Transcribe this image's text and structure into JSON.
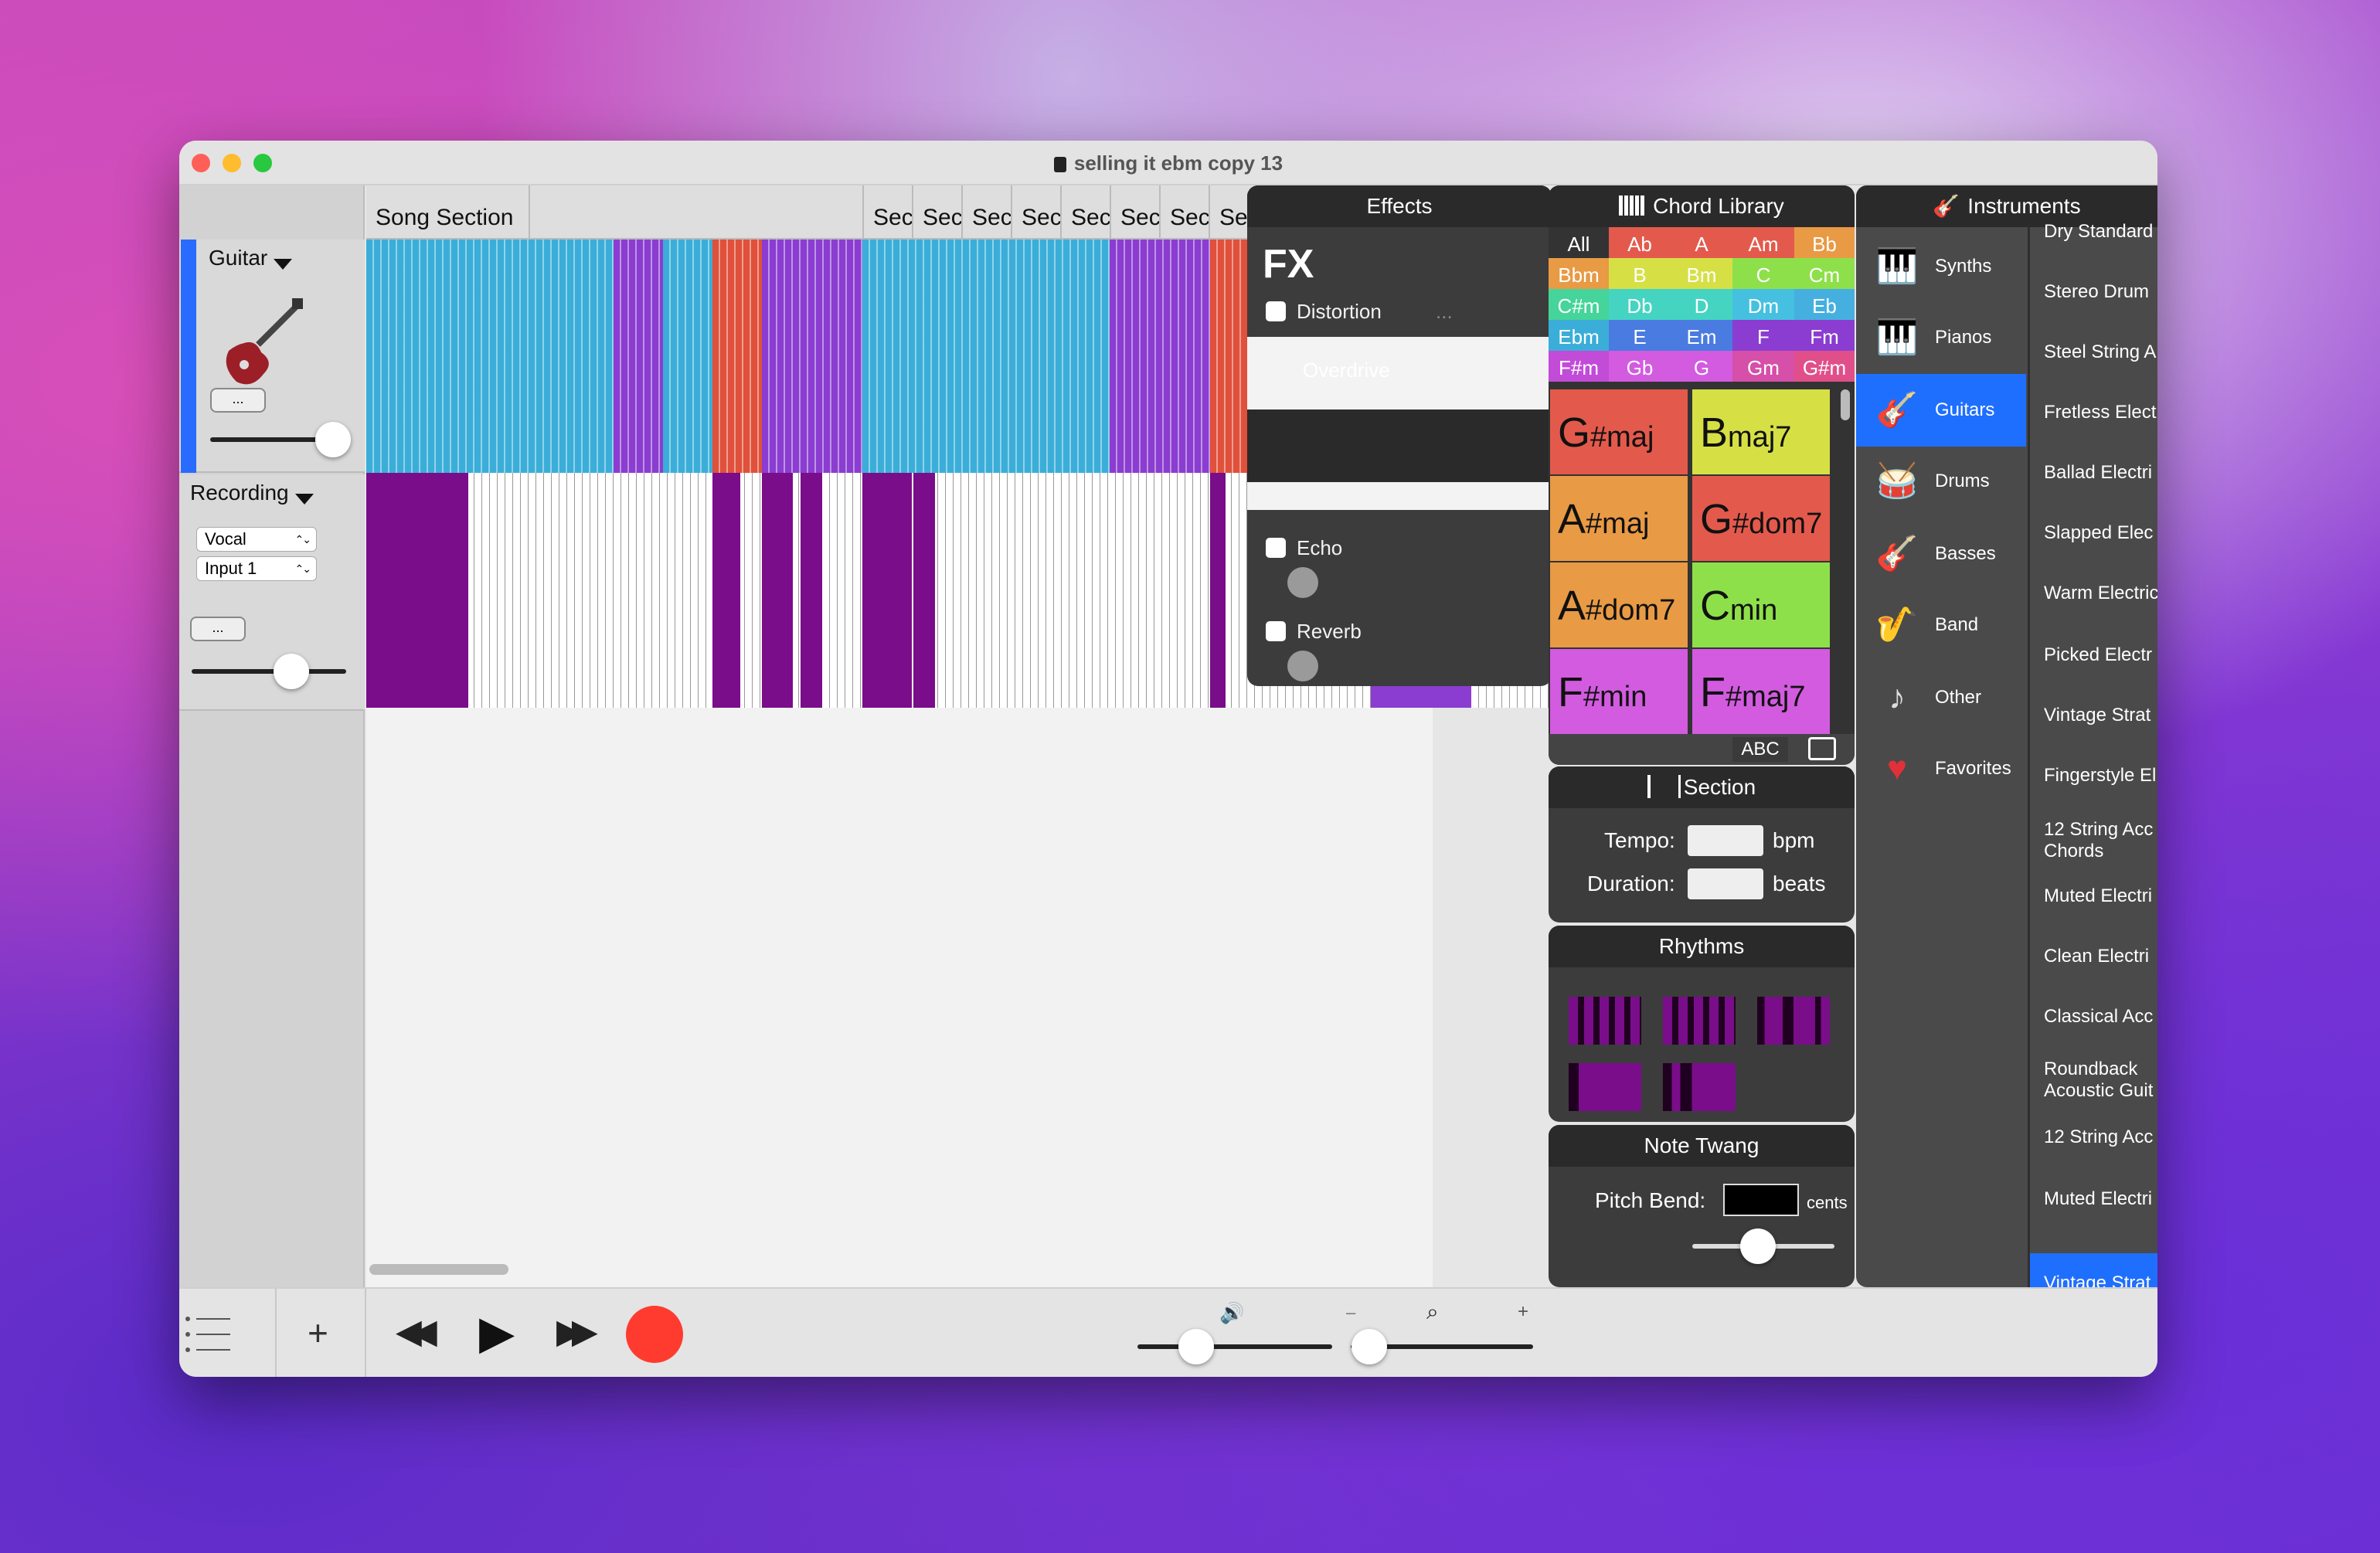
{
  "window": {
    "title": "selling it ebm copy 13"
  },
  "tracks": {
    "track1": {
      "name": "Guitar",
      "more_label": "..."
    },
    "track2": {
      "name": "Recording",
      "type": "Vocal",
      "input": "Input 1",
      "more_label": "..."
    }
  },
  "timeline": {
    "sections": [
      "Song Section",
      "",
      "Sec",
      "Sec",
      "Sec",
      "Sec",
      "Sec",
      "Sec",
      "Sec",
      "Sec"
    ]
  },
  "effects": {
    "title": "Effects",
    "fx_heading": "FX",
    "distortion": "Distortion",
    "distortion_more": "...",
    "overdrive": "Overdrive",
    "echo": "Echo",
    "reverb": "Reverb"
  },
  "chord_library": {
    "title": "Chord Library",
    "keys": [
      [
        "All",
        "Ab",
        "A",
        "Am",
        "Bb"
      ],
      [
        "Bbm",
        "B",
        "Bm",
        "C",
        "Cm"
      ],
      [
        "C#m",
        "Db",
        "D",
        "Dm",
        "Eb"
      ],
      [
        "Ebm",
        "E",
        "Em",
        "F",
        "Fm"
      ],
      [
        "F#m",
        "Gb",
        "G",
        "Gm",
        "G#m"
      ]
    ],
    "cards": [
      {
        "root": "G",
        "suffix": "#maj",
        "color": "#e35a4c"
      },
      {
        "root": "B",
        "suffix": "maj7",
        "color": "#d6e045"
      },
      {
        "root": "A",
        "suffix": "#maj",
        "color": "#e89a45"
      },
      {
        "root": "G",
        "suffix": "#dom7",
        "color": "#e35a4c"
      },
      {
        "root": "A",
        "suffix": "#dom7",
        "color": "#e89a45"
      },
      {
        "root": "C",
        "suffix": "min",
        "color": "#8ee04a"
      },
      {
        "root": "F",
        "suffix": "#min",
        "color": "#d25be0"
      },
      {
        "root": "F",
        "suffix": "#maj7",
        "color": "#d25be0"
      }
    ],
    "abc_label": "ABC"
  },
  "section": {
    "title": "Section",
    "tempo_label": "Tempo:",
    "tempo_unit": "bpm",
    "duration_label": "Duration:",
    "duration_unit": "beats"
  },
  "rhythms": {
    "title": "Rhythms"
  },
  "note_twang": {
    "title": "Note Twang",
    "pitch_label": "Pitch Bend:",
    "pitch_unit": "cents"
  },
  "instruments": {
    "title": "Instruments",
    "categories": [
      "Synths",
      "Pianos",
      "Guitars",
      "Drums",
      "Basses",
      "Band",
      "Other",
      "Favorites"
    ],
    "active_category": "Guitars",
    "items": [
      "Dry Standard",
      "Stereo Drum",
      "Steel String A",
      "Fretless Elect",
      "Ballad Electri",
      "Slapped Elec",
      "Warm Electric",
      "Picked Electr",
      "Vintage Strat",
      "Fingerstyle El",
      "12 String Acc Chords",
      "Muted Electri",
      "Clean Electri",
      "Classical Acc",
      "Roundback Acoustic Guit",
      "12 String Acc",
      "Muted Electri",
      "Vintage Strat"
    ],
    "active_item": "Vintage Strat"
  },
  "transport": {
    "volume": 0.3,
    "zoom": 0.1
  },
  "colors": {
    "accent": "#1f6fff",
    "record": "#ff3b30",
    "cyan": "#3aaed8",
    "purple": "#8a3dd0",
    "red": "#e0503a",
    "magenta": "#7a0d8a"
  }
}
